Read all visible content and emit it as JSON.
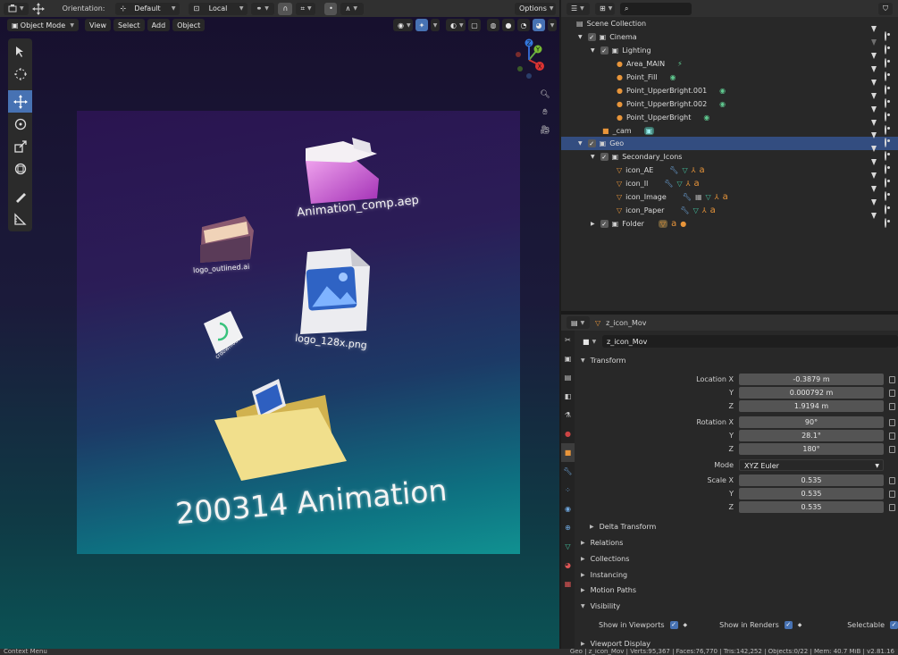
{
  "viewport_header": {
    "orientation_label": "Orientation:",
    "orientation_value": "Default",
    "pivot_value": "Local",
    "options_label": "Options"
  },
  "viewport_menu": {
    "mode": "Object Mode",
    "items": [
      "View",
      "Select",
      "Add",
      "Object"
    ]
  },
  "render_labels": {
    "comp": "Animation_comp.aep",
    "logo_ai": "logo_outlined.ai",
    "logo_png": "logo_128x.png",
    "download": "crdownload",
    "main": "200314 Animation"
  },
  "outliner": {
    "search_placeholder": "",
    "rows": [
      {
        "label": "Scene Collection"
      },
      {
        "label": "Cinema"
      },
      {
        "label": "Lighting"
      },
      {
        "label": "Area_MAIN"
      },
      {
        "label": "Point_Fill"
      },
      {
        "label": "Point_UpperBright.001"
      },
      {
        "label": "Point_UpperBright.002"
      },
      {
        "label": "Point_UpperBright"
      },
      {
        "label": "_cam"
      },
      {
        "label": "Geo"
      },
      {
        "label": "Secondary_Icons"
      },
      {
        "label": "icon_AE"
      },
      {
        "label": "icon_Il"
      },
      {
        "label": "icon_Image"
      },
      {
        "label": "icon_Paper"
      },
      {
        "label": "Folder"
      }
    ]
  },
  "properties": {
    "header_object": "z_icon_Mov",
    "object_name": "z_icon_Mov",
    "transform_label": "Transform",
    "location": {
      "label": "Location X",
      "x": "-0.3879 m",
      "y": "0.000792 m",
      "z": "1.9194 m"
    },
    "rotation": {
      "label": "Rotation X",
      "x": "90°",
      "y": "28.1°",
      "z": "180°"
    },
    "mode_label": "Mode",
    "mode_value": "XYZ Euler",
    "scale": {
      "label": "Scale X",
      "x": "0.535",
      "y": "0.535",
      "z": "0.535"
    },
    "axis_y": "Y",
    "axis_z": "Z",
    "sections": [
      "Delta Transform",
      "Relations",
      "Collections",
      "Instancing",
      "Motion Paths",
      "Visibility"
    ],
    "visibility": {
      "show_viewports": "Show in Viewports",
      "show_renders": "Show in Renders",
      "selectable": "Selectable"
    },
    "viewport_display": "Viewport Display"
  },
  "status_bar": {
    "left": "Context Menu",
    "right": "Geo | z_icon_Mov | Verts:95,367 | Faces:76,770 | Tris:142,252 | Objects:0/22 | Mem: 40.7 MiB | v2.81.16"
  },
  "colors": {
    "accent": "#4772b3",
    "selected_row": "#334d80",
    "light_green": "#5fc88f",
    "mesh_green": "#44c1a0",
    "orange": "#e8953a"
  }
}
